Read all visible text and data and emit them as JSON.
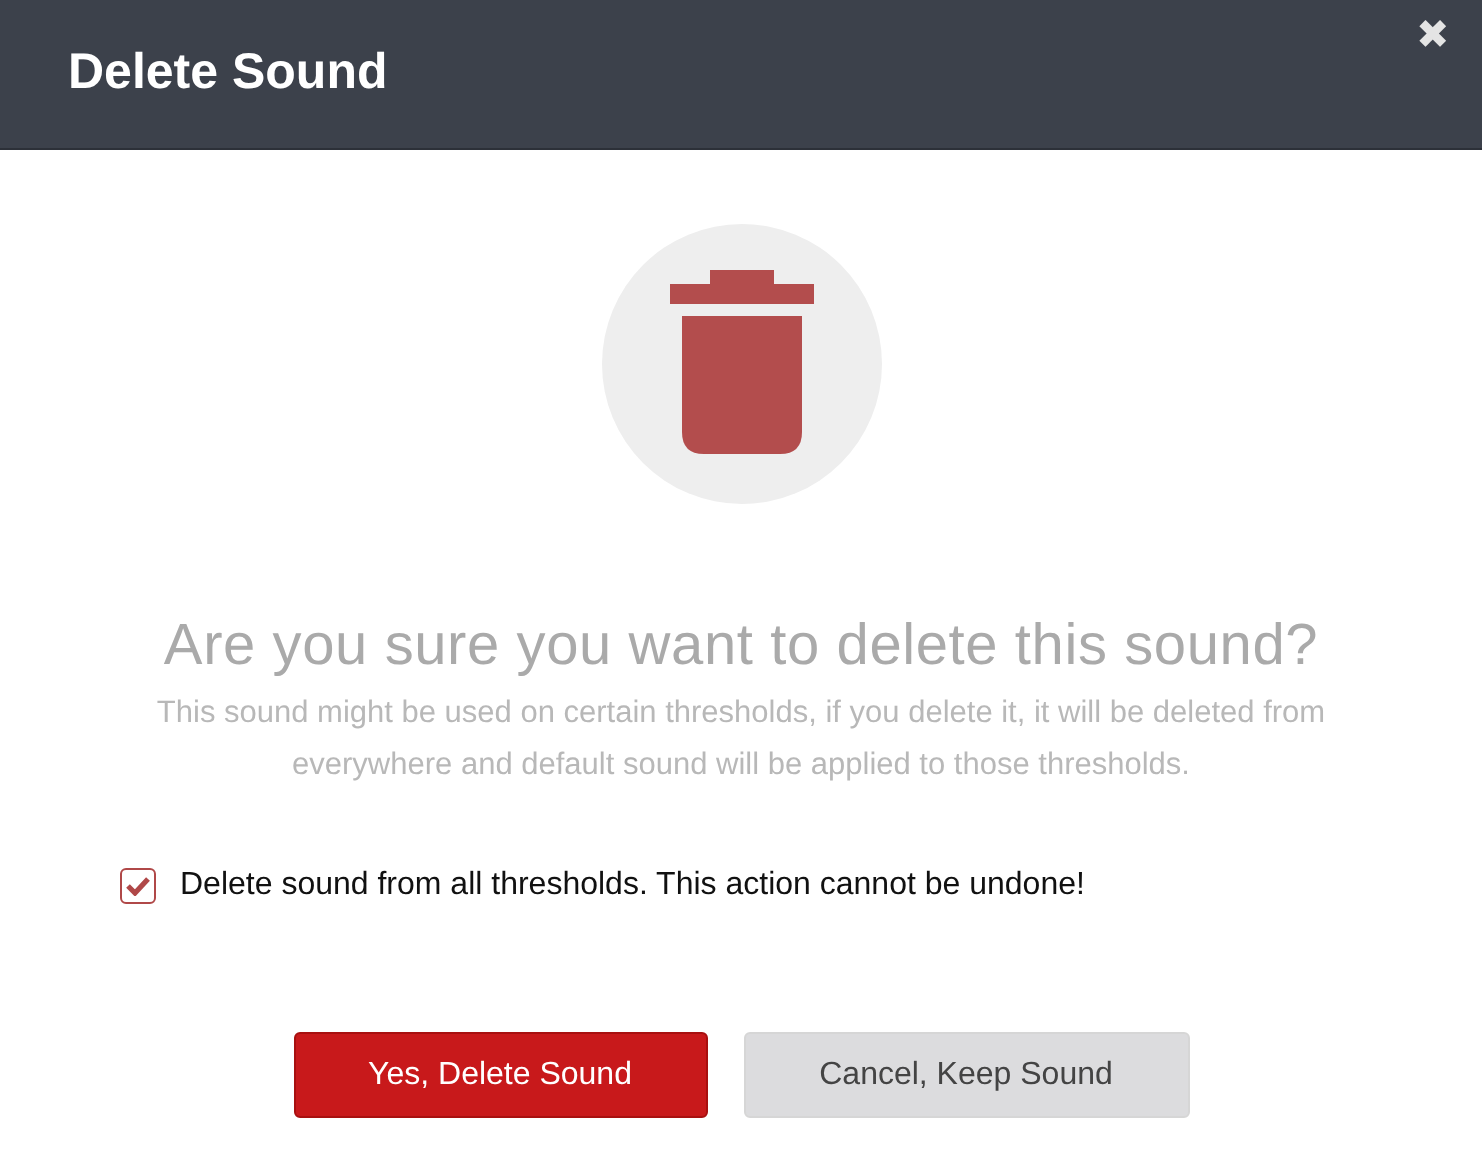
{
  "dialog": {
    "title": "Delete Sound",
    "close_label": "✖"
  },
  "question": "Are you sure you want to delete this sound?",
  "message": "This sound might be used on certain thresholds, if you delete it, it will be deleted from everywhere and default sound will be applied to those thresholds.",
  "confirm_option": {
    "label": "Delete sound from all thresholds. This action cannot be undone!",
    "checked": true
  },
  "buttons": [
    {
      "label": "Yes, Delete Sound",
      "kind": "primary"
    },
    {
      "label": "Cancel, Keep Sound",
      "kind": "secondary"
    }
  ]
}
